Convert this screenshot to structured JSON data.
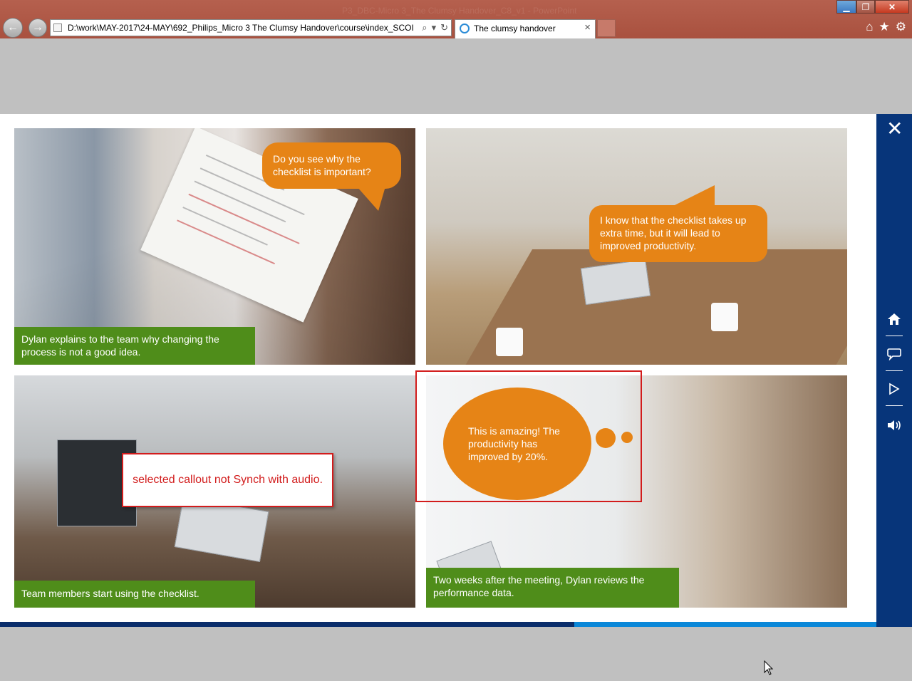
{
  "browser": {
    "window_title": "P3_DBC-Micro 3_The Clumsy Handover_C8_v1 - PowerPoint",
    "address_url": "D:\\work\\MAY-2017\\24-MAY\\692_Philips_Micro 3 The Clumsy Handover\\course\\index_SCOI",
    "tab_title": "The clumsy handover",
    "tab_close": "×",
    "back_glyph": "←",
    "forward_glyph": "→",
    "min_glyph": "▁",
    "max_glyph": "❐",
    "close_glyph": "✕",
    "search_glyph": "⌕",
    "refresh_glyph": "↻",
    "home_glyph": "⌂",
    "star_glyph": "★",
    "gear_glyph": "⚙"
  },
  "course": {
    "close_glyph": "✕",
    "side_buttons": [
      {
        "icon": "home-icon",
        "glyph": "⌂"
      },
      {
        "icon": "speech-bubble-icon",
        "glyph": "▭"
      },
      {
        "icon": "play-icon",
        "glyph": "▷"
      },
      {
        "icon": "speaker-icon",
        "glyph": "🔊"
      }
    ],
    "progress_fraction": 0.655,
    "colors": {
      "caption_green": "#4f8d1a",
      "bubble_orange": "#e68416",
      "side_blue": "#07357a",
      "progress_light": "#0a87d8",
      "annotation_red": "#d21c1c"
    },
    "panels": [
      {
        "caption": "Dylan explains to the team why changing the process is not a good idea.",
        "bubble": "Do you see why the checklist is important?"
      },
      {
        "caption": "",
        "bubble": "I know that the checklist takes up extra time, but it will lead to improved productivity."
      },
      {
        "caption": "Team members start using the checklist.",
        "bubble": ""
      },
      {
        "caption": "Two weeks after the meeting, Dylan reviews the performance data.",
        "bubble": "This is amazing! The productivity has improved by 20%."
      }
    ]
  },
  "annotation": {
    "text": "selected callout not Synch with audio."
  }
}
